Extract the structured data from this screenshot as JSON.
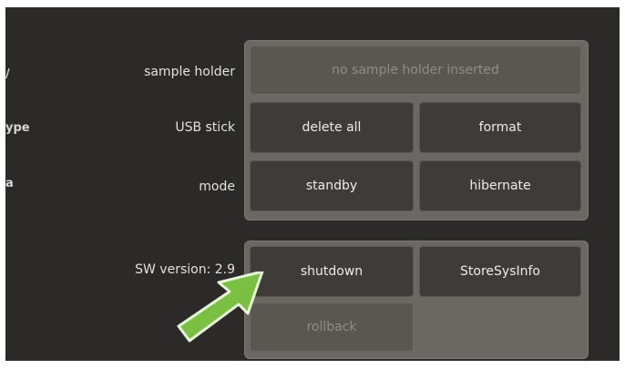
{
  "left_fragments": {
    "row1": "/",
    "row2": "ype",
    "row3": "a"
  },
  "labels": {
    "sample_holder": "sample holder",
    "usb_stick": "USB stick",
    "mode": "mode",
    "sw_version": "SW version: 2.9"
  },
  "buttons": {
    "no_sample_holder": "no sample holder inserted",
    "delete_all": "delete all",
    "format": "format",
    "standby": "standby",
    "hibernate": "hibernate",
    "shutdown": "shutdown",
    "store_sys_info": "StoreSysInfo",
    "rollback": "rollback"
  },
  "colors": {
    "screen_bg": "#2b2a28",
    "panel_bg": "#6b6762",
    "button_bg": "#3e3b38",
    "arrow": "#7ac143"
  },
  "icons": {
    "pointer": "green-arrow-icon"
  }
}
